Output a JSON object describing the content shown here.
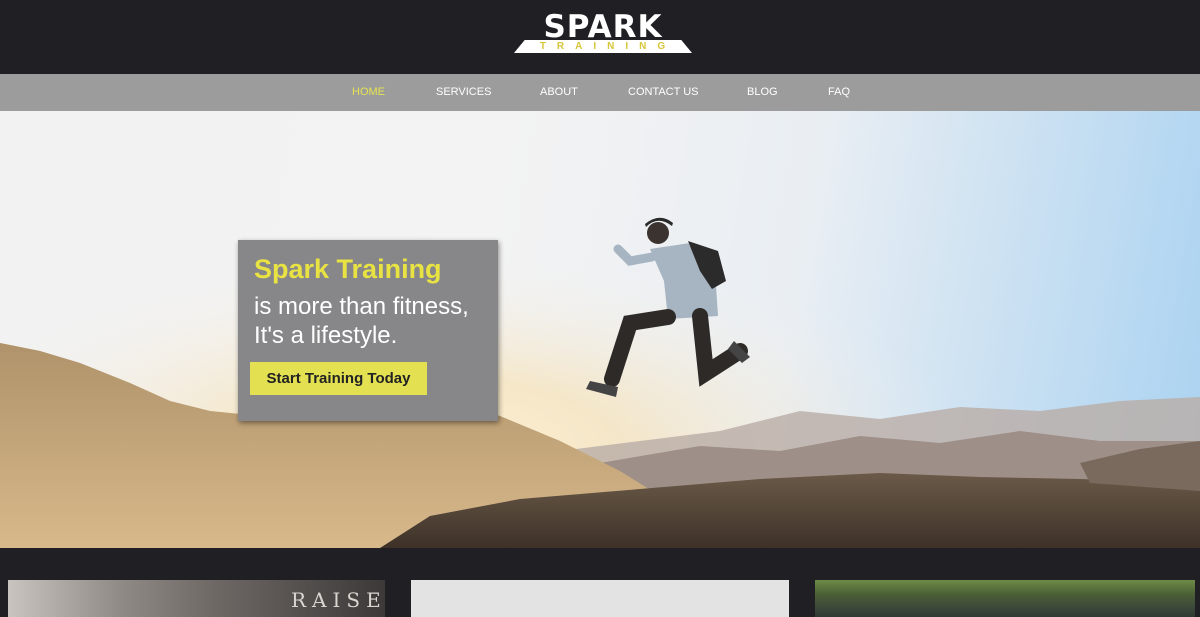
{
  "brand": {
    "logo_word": "SPARK",
    "logo_sub": "TRAINING"
  },
  "nav": {
    "items": [
      "HOME",
      "SERVICES",
      "ABOUT",
      "CONTACT US",
      "BLOG",
      "FAQ"
    ],
    "active": "HOME"
  },
  "hero": {
    "title": "Spark Training",
    "subtitle_line1": "is more than fitness,",
    "subtitle_line2": "It's a lifestyle.",
    "cta_label": "Start Training Today"
  },
  "cards": {
    "card1_text": "RAISE"
  },
  "colors": {
    "dark_bg": "#201f24",
    "nav_bg": "#9c9c9c",
    "accent_yellow": "#e3e052",
    "promo_bg": "#878689"
  }
}
